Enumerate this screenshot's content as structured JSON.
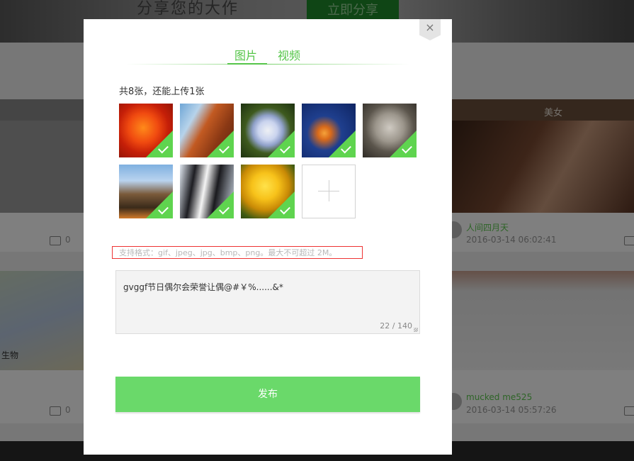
{
  "background": {
    "banner_text": "分享您的大作",
    "banner_button": "立即分享",
    "cards": [
      {
        "category": "",
        "comment_count": "0"
      },
      {
        "category": "美女",
        "user": "人间四月天",
        "time": "2016-03-14 06:02:41"
      },
      {
        "label": "生物",
        "comment_count": "0"
      },
      {
        "user": "mucked me525",
        "time": "2016-03-14 05:57:26"
      }
    ]
  },
  "modal": {
    "close_label": "×",
    "tabs": [
      {
        "label": "图片",
        "active": true
      },
      {
        "label": "视频",
        "active": false
      }
    ],
    "upload_status": "共8张，还能上传1张",
    "images": [
      {
        "name": "red-flower"
      },
      {
        "name": "desert-rock"
      },
      {
        "name": "hydrangea"
      },
      {
        "name": "jellyfish"
      },
      {
        "name": "koala"
      },
      {
        "name": "lighthouse"
      },
      {
        "name": "penguins"
      },
      {
        "name": "tulips"
      }
    ],
    "format_note": "支持格式：gif、jpeg、jpg、bmp、png。最大不可超过 2M。",
    "textarea": {
      "value": "gvggf节日偶尔会荣誉让偶@#￥%......&*",
      "char_count": "22 / 140"
    },
    "publish_button": "发布",
    "accent_color": "#55c549"
  }
}
